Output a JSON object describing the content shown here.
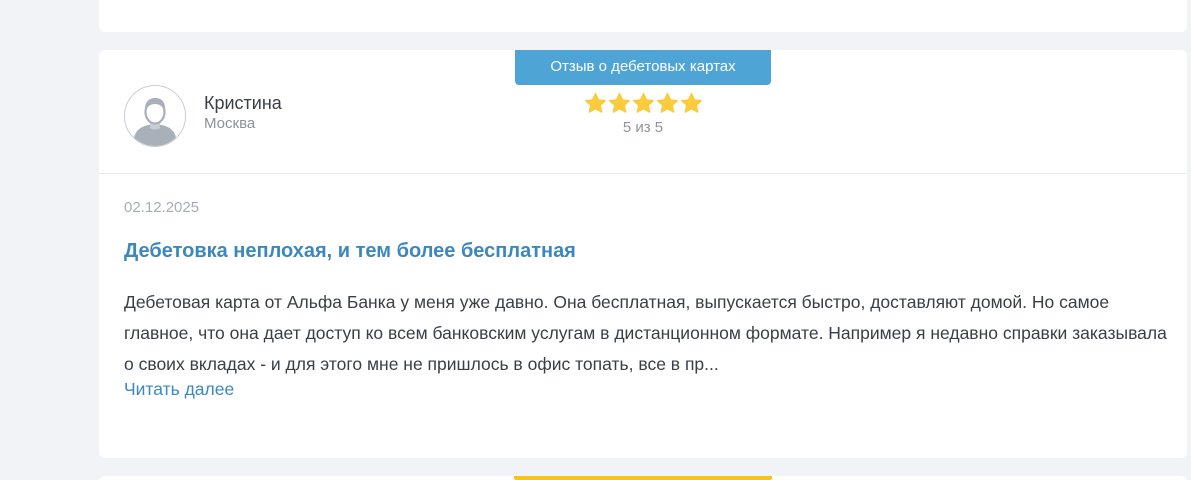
{
  "review": {
    "category_tag": "Отзыв о дебетовых картах",
    "author": {
      "name": "Кристина",
      "city": "Москва",
      "avatar_icon": "user-avatar-icon"
    },
    "rating": {
      "stars": 5,
      "max": 5,
      "text": "5 из 5",
      "star_icon": "star-icon",
      "star_color": "#f9cb3d"
    },
    "date": "02.12.2025",
    "title": "Дебетовка неплохая, и тем более бесплатная",
    "text": "Дебетовая карта от Альфа Банка у меня уже давно. Она бесплатная, выпускается быстро, доставляют домой. Но самое главное, что она дает доступ ко всем банковским услугам в дистанционном формате. Например я недавно справки заказывала о своих вкладах - и для этого мне не пришлось в офис топать, все в пр...",
    "read_more": "Читать далее"
  },
  "colors": {
    "accent": "#3b88bf",
    "tag_background": "#4fa4d6",
    "next_tag": "#f5c518",
    "page_background": "#f1f3f6"
  }
}
